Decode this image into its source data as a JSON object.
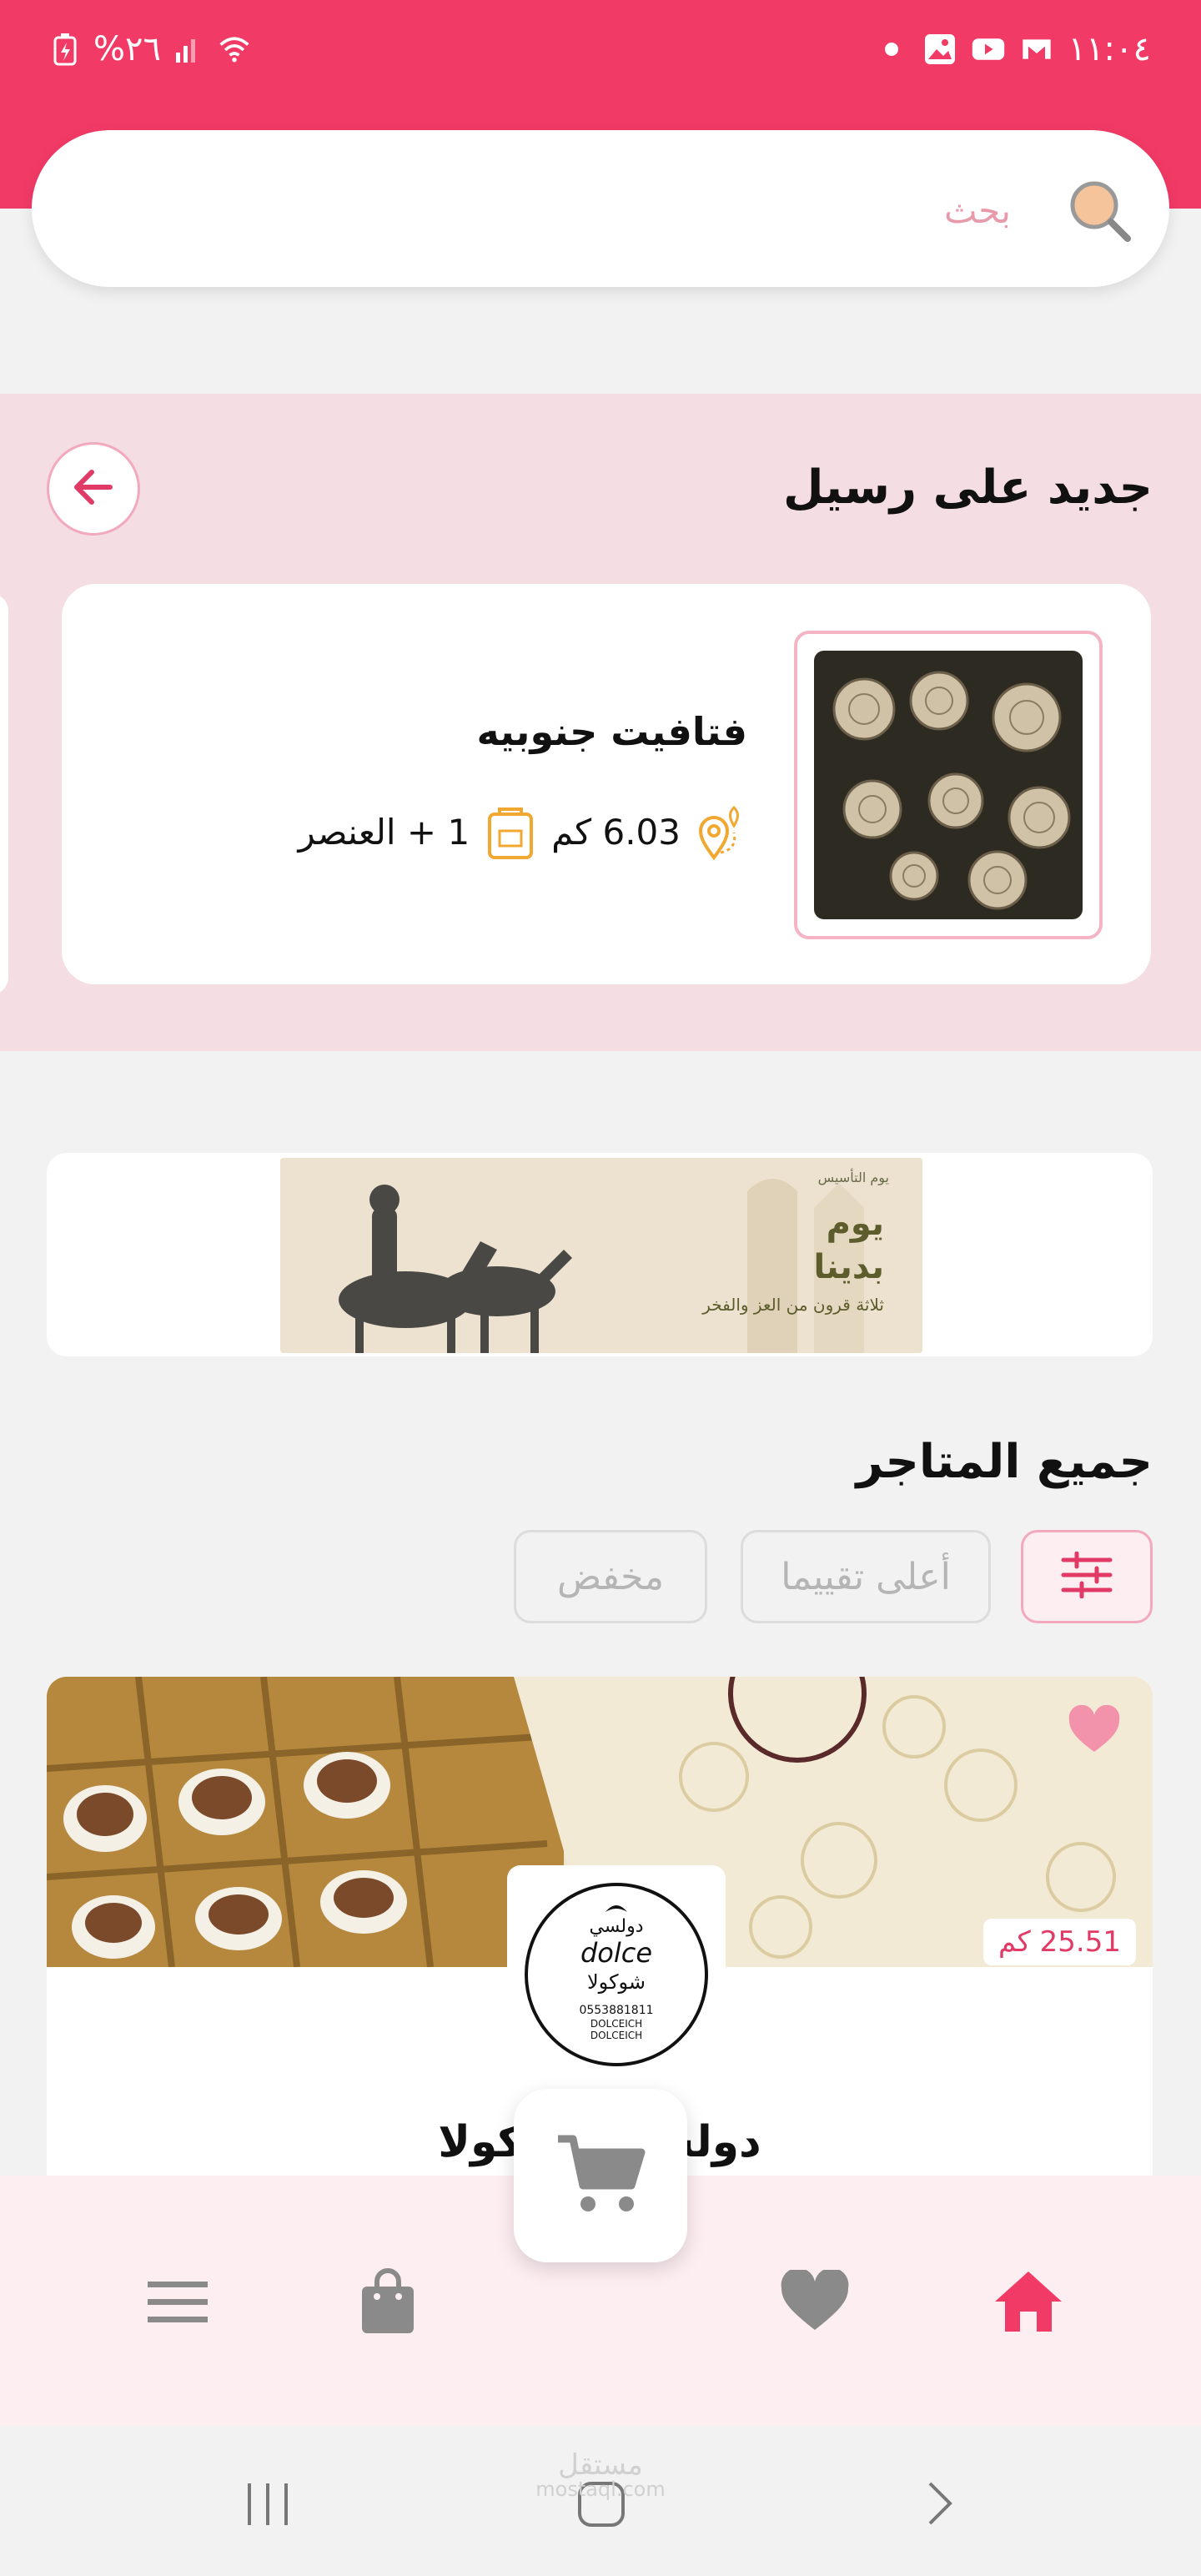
{
  "status_bar": {
    "time": "١١:٠٤",
    "battery_percent": "%٢٦",
    "icons": [
      "notification-dot-icon",
      "gallery-icon",
      "youtube-icon",
      "gmail-icon",
      "signal-icon",
      "wifi-icon",
      "battery-icon"
    ]
  },
  "search": {
    "placeholder": "بحث"
  },
  "new_section": {
    "title": "جديد على رسيل",
    "card": {
      "name": "فتافيت جنوبيه",
      "distance": "6.03 كم",
      "items": "1 + العنصر"
    }
  },
  "banner": {
    "line1": "يوم",
    "line2": "بدينا",
    "line3": "ثلاثة قرون من العز والفخر",
    "logo_text": "يوم التأسيس"
  },
  "all_stores": {
    "title": "جميع المتاجر",
    "chips": [
      "أعلى تقييما",
      "مخفض"
    ],
    "store": {
      "distance": "25.51 كم",
      "name": "دولسي شوكولا",
      "logo_lines": [
        "دولسي",
        "dolce",
        "شوكولا",
        "0553881811",
        "DOLCEICH",
        "DOLCEICH"
      ]
    }
  },
  "bottom_nav": {
    "items": [
      "home-icon",
      "heart-icon",
      "cart-icon",
      "bag-icon",
      "menu-icon"
    ],
    "active": "home-icon",
    "accent": "#f23a66"
  },
  "watermark": {
    "line1": "مستقل",
    "line2": "mostaql.com"
  },
  "colors": {
    "brand": "#f23a66",
    "section_bg": "#f4dde3",
    "card_bg": "#ffffff"
  }
}
